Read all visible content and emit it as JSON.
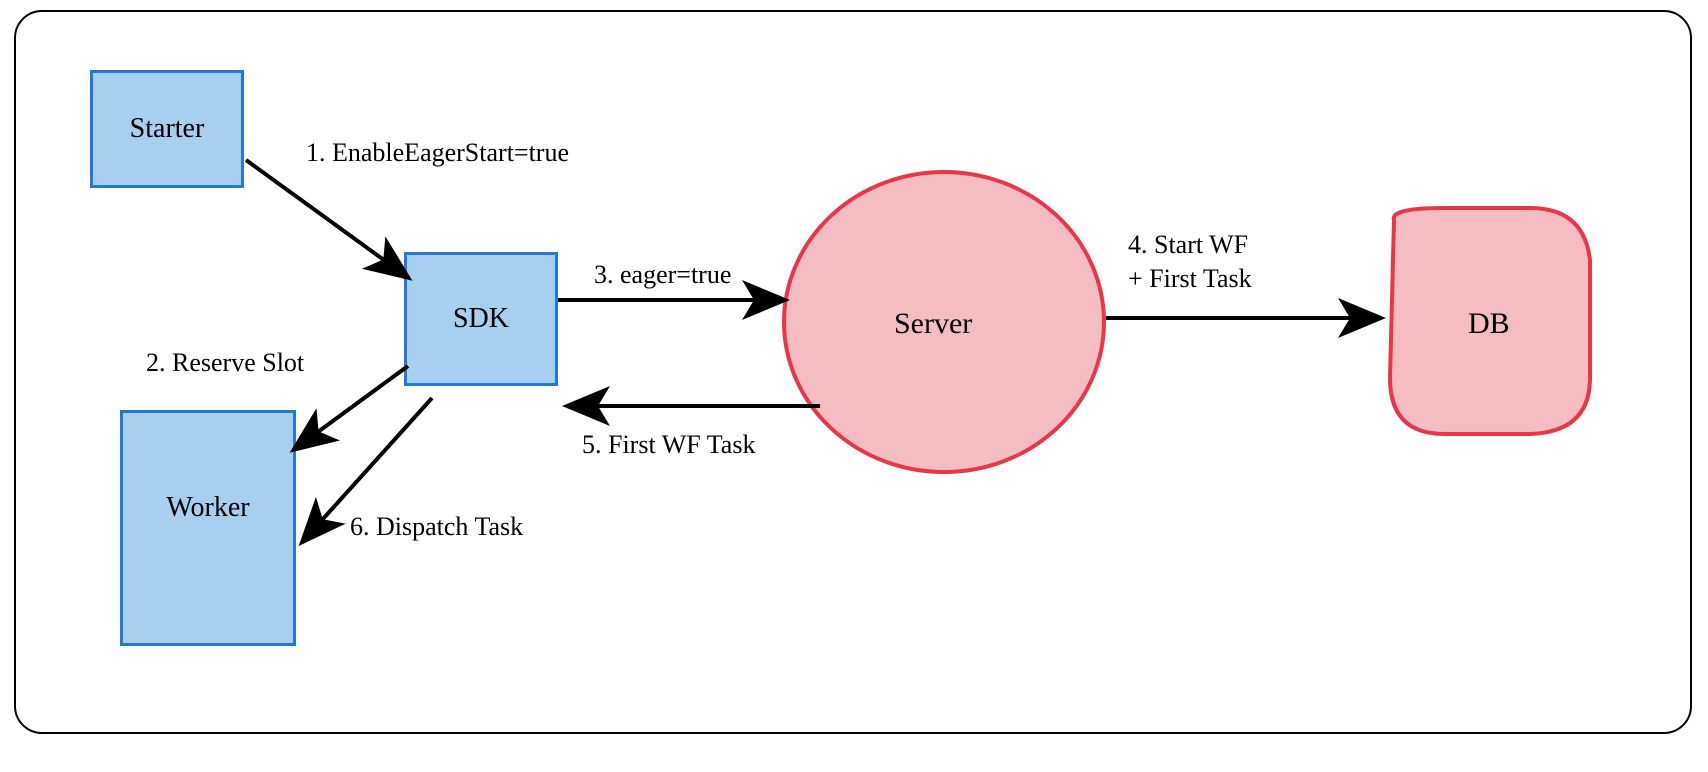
{
  "nodes": {
    "starter": "Starter",
    "sdk": "SDK",
    "worker": "Worker",
    "server": "Server",
    "db": "DB"
  },
  "edges": {
    "e1": "1. EnableEagerStart=true",
    "e2": "2. Reserve Slot",
    "e3": "3. eager=true",
    "e4": "4. Start WF\n+ First Task",
    "e5": "5. First WF Task",
    "e6": "6. Dispatch Task"
  },
  "colors": {
    "blue_stroke": "#2678d6",
    "blue_fill": "#a7cff0",
    "red_stroke": "#e6384a",
    "red_fill": "#f5bdc2"
  }
}
